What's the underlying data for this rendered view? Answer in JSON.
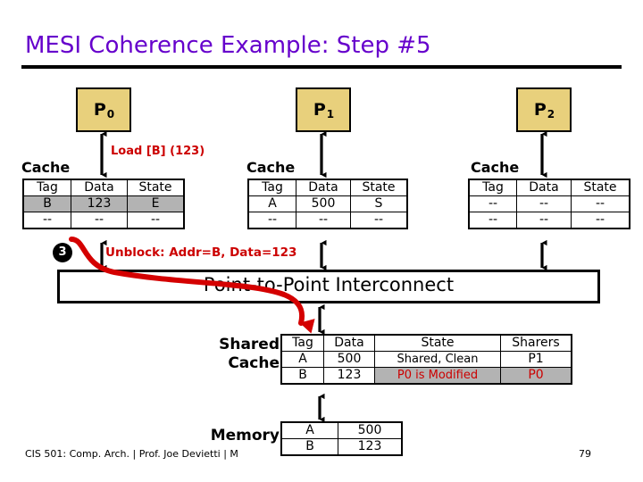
{
  "slide": {
    "title": "MESI Coherence Example: Step #5",
    "page_number": "79",
    "footer": "CIS 501: Comp. Arch.  |  Prof. Joe Devietti  |  M",
    "interconnect_label": "Point-to-Point Interconnect",
    "title_color": "#6600cc",
    "accent_red": "#cc0000",
    "proc_fill": "#e8d07c",
    "highlight_gray": "#b3b3b3"
  },
  "processors": [
    {
      "name": "P",
      "index": "0",
      "cache_label": "Cache",
      "annotation": "Load [B] (123)",
      "columns": [
        "Tag",
        "Data",
        "State"
      ],
      "rows": [
        {
          "cells": [
            "B",
            "123",
            "E"
          ],
          "highlight": true
        },
        {
          "cells": [
            "--",
            "--",
            "--"
          ],
          "highlight": false
        }
      ]
    },
    {
      "name": "P",
      "index": "1",
      "cache_label": "Cache",
      "annotation": "",
      "columns": [
        "Tag",
        "Data",
        "State"
      ],
      "rows": [
        {
          "cells": [
            "A",
            "500",
            "S"
          ],
          "highlight": false
        },
        {
          "cells": [
            "--",
            "--",
            "--"
          ],
          "highlight": false
        }
      ]
    },
    {
      "name": "P",
      "index": "2",
      "cache_label": "Cache",
      "annotation": "",
      "columns": [
        "Tag",
        "Data",
        "State"
      ],
      "rows": [
        {
          "cells": [
            "--",
            "--",
            "--"
          ],
          "highlight": false
        },
        {
          "cells": [
            "--",
            "--",
            "--"
          ],
          "highlight": false
        }
      ]
    }
  ],
  "step": {
    "number": "3",
    "message": "Unblock: Addr=B, Data=123"
  },
  "shared_cache": {
    "label_line1": "Shared",
    "label_line2": "Cache",
    "columns": [
      "Tag",
      "Data",
      "State",
      "Sharers"
    ],
    "rows": [
      {
        "cells": [
          "A",
          "500",
          "Shared, Clean",
          "P1"
        ],
        "styles": [
          "plain",
          "plain",
          "plain",
          "plain"
        ]
      },
      {
        "cells": [
          "B",
          "123",
          "P0 is Modified",
          "P0"
        ],
        "styles": [
          "plain",
          "plain",
          "gray-red",
          "gray-red"
        ]
      }
    ]
  },
  "memory": {
    "label": "Memory",
    "rows": [
      {
        "cells": [
          "A",
          "500"
        ]
      },
      {
        "cells": [
          "B",
          "123"
        ]
      }
    ]
  }
}
